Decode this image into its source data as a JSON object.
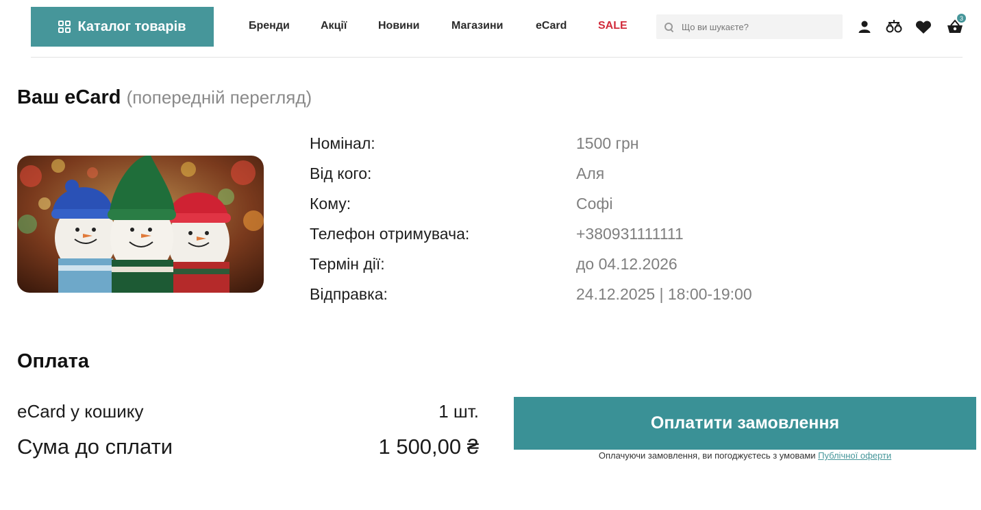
{
  "header": {
    "catalog_label": "Каталог товарів",
    "nav": [
      {
        "label": "Бренди"
      },
      {
        "label": "Акції"
      },
      {
        "label": "Новини"
      },
      {
        "label": "Магазини"
      },
      {
        "label": "eCard"
      },
      {
        "label": "SALE"
      }
    ],
    "search_placeholder": "Що ви шукаєте?",
    "cart_count": "3",
    "accent_color": "#46969a",
    "sale_color": "#d12b3b",
    "icons": [
      "grid-icon",
      "search-icon",
      "user-icon",
      "compare-icon",
      "heart-icon",
      "basket-icon"
    ]
  },
  "preview": {
    "title": "Ваш eCard",
    "subtitle": "(попередній перегляд)",
    "image_alt": "snowmen-card-image",
    "details": [
      {
        "label": "Номінал:",
        "value": "1500 грн"
      },
      {
        "label": "Від кого:",
        "value": "Аля"
      },
      {
        "label": "Кому:",
        "value": "Софі"
      },
      {
        "label": "Телефон отримувача:",
        "value": "+380931111111"
      },
      {
        "label": "Термін дії:",
        "value": "до 04.12.2026"
      },
      {
        "label": "Відправка:",
        "value": "24.12.2025 | 18:00-19:00"
      }
    ]
  },
  "payment": {
    "title": "Оплата",
    "cart_label": "eCard у кошику",
    "cart_qty": "1 шт.",
    "total_label": "Сума до сплати",
    "total_value": "1 500,00 ₴",
    "pay_button": "Оплатити замовлення",
    "terms_text": "Оплачуючи замовлення, ви погоджуєтесь з умовами ",
    "terms_link": "Публічної оферти"
  }
}
